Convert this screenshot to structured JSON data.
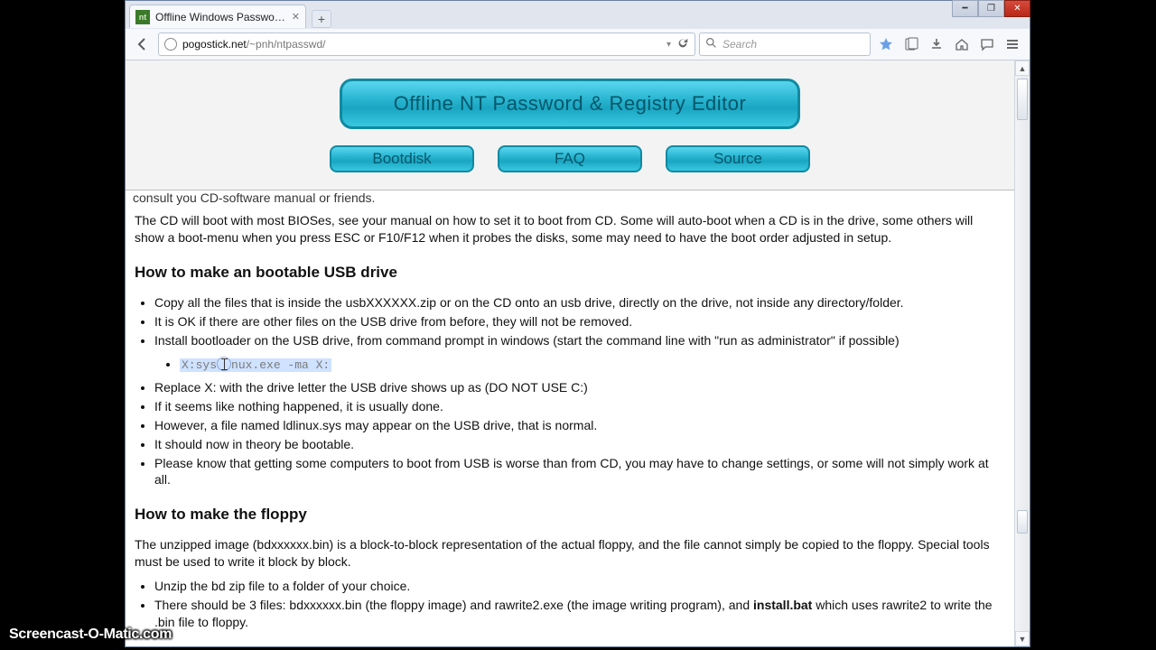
{
  "tab": {
    "title": "Offline Windows Password..."
  },
  "url": {
    "host": "pogostick.net",
    "path": "/~pnh/ntpasswd/"
  },
  "search": {
    "placeholder": "Search"
  },
  "banner": {
    "title": "Offline NT Password & Registry Editor"
  },
  "nav": [
    {
      "label": "Bootdisk"
    },
    {
      "label": "FAQ"
    },
    {
      "label": "Source"
    }
  ],
  "content": {
    "truncated_top": "consult you CD-software manual or friends.",
    "p1": "The CD will boot with most BIOSes, see your manual on how to set it to boot from CD. Some will auto-boot when a CD is in the drive, some others will show a boot-menu when you press ESC or F10/F12 when it probes the disks, some may need to have the boot order adjusted in setup.",
    "h1": "How to make an bootable USB drive",
    "usb_li1": "Copy all the files that is inside the usbXXXXXX.zip or on the CD onto an usb drive, directly on the drive, not inside any directory/folder.",
    "usb_li2": "It is OK if there are other files on the USB drive from before, they will not be removed.",
    "usb_li3": "Install bootloader on the USB drive, from command prompt in windows (start the command line with \"run as administrator\" if possible)",
    "code_pre": "X:sys",
    "code_post": "nux.exe -ma X:",
    "usb_li4": "Replace X: with the drive letter the USB drive shows up as (DO NOT USE C:)",
    "usb_li5": "If it seems like nothing happened, it is usually done.",
    "usb_li6": "However, a file named ldlinux.sys may appear on the USB drive, that is normal.",
    "usb_li7": "It should now in theory be bootable.",
    "usb_li8": "Please know that getting some computers to boot from USB is worse than from CD, you may have to change settings, or some will not simply work at all.",
    "h2": "How to make the floppy",
    "p2": "The unzipped image (bdxxxxxx.bin) is a block-to-block representation of the actual floppy, and the file cannot simply be copied to the floppy. Special tools must be used to write it block by block.",
    "fl_li1": "Unzip the bd zip file to a folder of your choice.",
    "fl_li2_a": "There should be 3 files: bdxxxxxx.bin (the floppy image) and rawrite2.exe (the image writing program), and ",
    "fl_li2_bold": "install.bat",
    "fl_li2_b": " which uses rawrite2 to write the .bin file to floppy."
  },
  "watermark": "Screencast-O-Matic.com"
}
